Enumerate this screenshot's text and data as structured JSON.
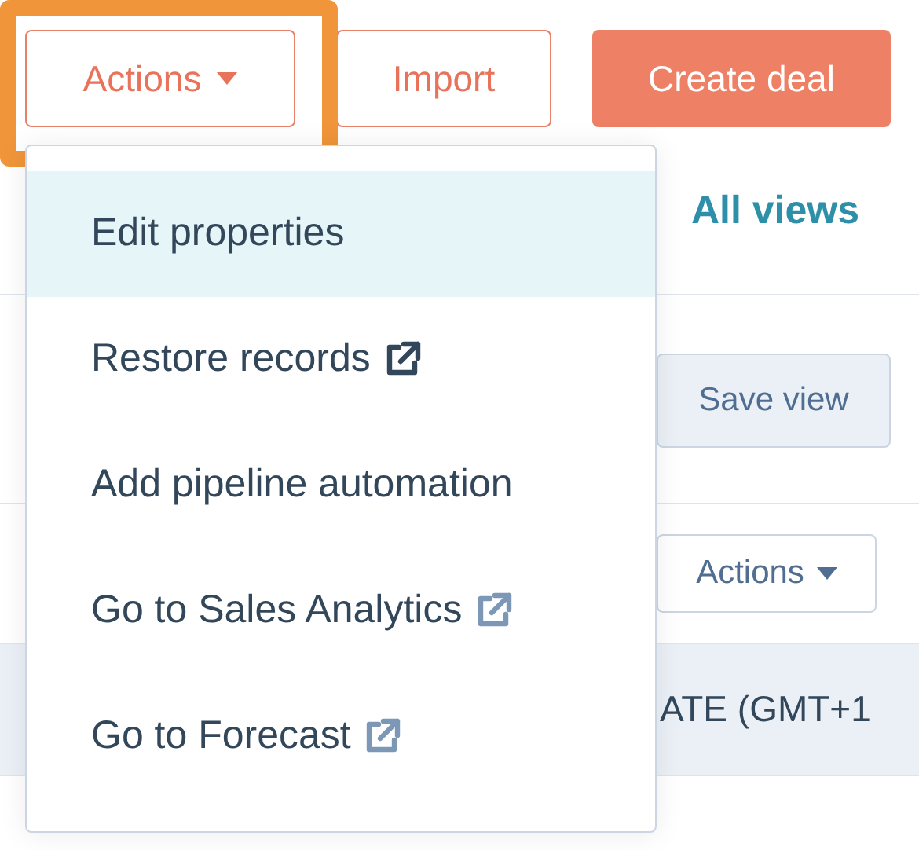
{
  "toolbar": {
    "actions_button": {
      "label": "Actions",
      "highlighted": true
    },
    "import_button": {
      "label": "Import"
    },
    "create_button": {
      "label": "Create deal"
    }
  },
  "views": {
    "all_views_link": "All views",
    "save_view_button": "Save view"
  },
  "table": {
    "actions_button": "Actions",
    "header_cell": "ATE (GMT+1"
  },
  "menu": {
    "items": [
      {
        "label": "Edit properties",
        "selected": true,
        "kind": "plain"
      },
      {
        "label": "Restore records",
        "selected": false,
        "kind": "external",
        "color": "#33475b"
      },
      {
        "label": "Add pipeline automation",
        "selected": false,
        "kind": "plain"
      },
      {
        "label": "Go to Sales Analytics",
        "selected": false,
        "kind": "external",
        "color": "#7c98b6"
      },
      {
        "label": "Go to Forecast",
        "selected": false,
        "kind": "external",
        "color": "#7c98b6"
      }
    ]
  }
}
